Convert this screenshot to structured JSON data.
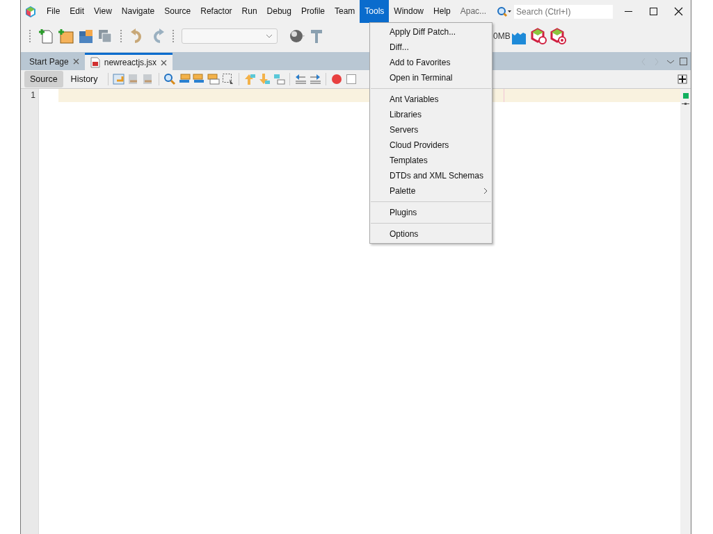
{
  "menu_bar": {
    "items": [
      {
        "label": "File",
        "selected": false
      },
      {
        "label": "Edit",
        "selected": false
      },
      {
        "label": "View",
        "selected": false
      },
      {
        "label": "Navigate",
        "selected": false
      },
      {
        "label": "Source",
        "selected": false
      },
      {
        "label": "Refactor",
        "selected": false
      },
      {
        "label": "Run",
        "selected": false
      },
      {
        "label": "Debug",
        "selected": false
      },
      {
        "label": "Profile",
        "selected": false
      },
      {
        "label": "Team",
        "selected": false
      },
      {
        "label": "Tools",
        "selected": true
      },
      {
        "label": "Window",
        "selected": false
      },
      {
        "label": "Help",
        "selected": false
      },
      {
        "label": "Apac...",
        "selected": false
      }
    ],
    "search": {
      "placeholder": "Search (Ctrl+I)"
    }
  },
  "toolbar": {
    "memory_label": "0MB"
  },
  "tools_menu": {
    "groups": [
      [
        {
          "label": "Apply Diff Patch...",
          "has_submenu": false
        },
        {
          "label": "Diff...",
          "has_submenu": false
        },
        {
          "label": "Add to Favorites",
          "has_submenu": false
        },
        {
          "label": "Open in Terminal",
          "has_submenu": false
        }
      ],
      [
        {
          "label": "Ant Variables",
          "has_submenu": false
        },
        {
          "label": "Libraries",
          "has_submenu": false
        },
        {
          "label": "Servers",
          "has_submenu": false
        },
        {
          "label": "Cloud Providers",
          "has_submenu": false
        },
        {
          "label": "Templates",
          "has_submenu": false
        },
        {
          "label": "DTDs and XML Schemas",
          "has_submenu": false
        },
        {
          "label": "Palette",
          "has_submenu": true
        }
      ],
      [
        {
          "label": "Plugins",
          "has_submenu": false
        }
      ],
      [
        {
          "label": "Options",
          "has_submenu": false
        }
      ]
    ]
  },
  "editor_tabs": [
    {
      "label": "Start Page",
      "selected": false,
      "kind": "page"
    },
    {
      "label": "newreactjs.jsx",
      "selected": true,
      "kind": "file"
    }
  ],
  "editor_toolbar": {
    "views": [
      {
        "label": "Source",
        "selected": true
      },
      {
        "label": "History",
        "selected": false
      }
    ]
  },
  "editor": {
    "line_numbers": [
      "1"
    ]
  }
}
